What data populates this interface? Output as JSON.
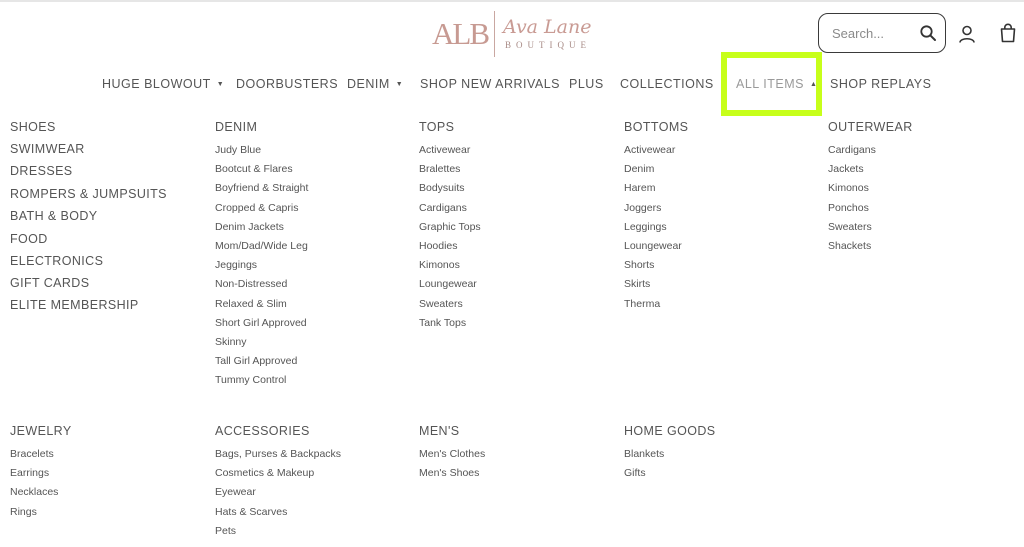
{
  "brand": {
    "monogram": "ALB",
    "script_name": "Ava Lane",
    "sub_name": "BOUTIQUE",
    "accent_color": "#c99b94"
  },
  "search": {
    "placeholder": "Search..."
  },
  "icons": {
    "search": "search-icon",
    "account": "account-icon",
    "cart": "shopping-bag-icon",
    "caret_down": "caret-down-icon",
    "caret_up": "caret-up-icon"
  },
  "highlight_color": "#c7ff1a",
  "nav": [
    {
      "label": "HUGE BLOWOUT",
      "has_caret": true
    },
    {
      "label": "DOORBUSTERS",
      "has_caret": false
    },
    {
      "label": "DENIM",
      "has_caret": true
    },
    {
      "label": "SHOP NEW ARRIVALS",
      "has_caret": false
    },
    {
      "label": "PLUS",
      "has_caret": false
    },
    {
      "label": "COLLECTIONS",
      "has_caret": true
    },
    {
      "label": "ALL ITEMS",
      "has_caret": true,
      "active": true
    },
    {
      "label": "SHOP REPLAYS",
      "has_caret": false
    }
  ],
  "menu": {
    "main_links": [
      "SHOES",
      "SWIMWEAR",
      "DRESSES",
      "ROMPERS & JUMPSUITS",
      "BATH & BODY",
      "FOOD",
      "ELECTRONICS",
      "GIFT CARDS",
      "ELITE MEMBERSHIP"
    ],
    "denim": {
      "heading": "DENIM",
      "links": [
        "Judy Blue",
        "Bootcut & Flares",
        "Boyfriend & Straight",
        "Cropped & Capris",
        "Denim Jackets",
        "Mom/Dad/Wide Leg",
        "Jeggings",
        "Non-Distressed",
        "Relaxed & Slim",
        "Short Girl Approved",
        "Skinny",
        "Tall Girl Approved",
        "Tummy Control"
      ]
    },
    "tops": {
      "heading": "TOPS",
      "links": [
        "Activewear",
        "Bralettes",
        "Bodysuits",
        "Cardigans",
        "Graphic Tops",
        "Hoodies",
        "Kimonos",
        "Loungewear",
        "Sweaters",
        "Tank Tops"
      ]
    },
    "bottoms": {
      "heading": "BOTTOMS",
      "links": [
        "Activewear",
        "Denim",
        "Harem",
        "Joggers",
        "Leggings",
        "Loungewear",
        "Shorts",
        "Skirts",
        "Therma"
      ]
    },
    "outerwear": {
      "heading": "OUTERWEAR",
      "links": [
        "Cardigans",
        "Jackets",
        "Kimonos",
        "Ponchos",
        "Sweaters",
        "Shackets"
      ]
    },
    "jewelry": {
      "heading": "JEWELRY",
      "links": [
        "Bracelets",
        "Earrings",
        "Necklaces",
        "Rings"
      ]
    },
    "accessories": {
      "heading": "ACCESSORIES",
      "links": [
        "Bags, Purses & Backpacks",
        "Cosmetics & Makeup",
        "Eyewear",
        "Hats & Scarves",
        "Pets"
      ]
    },
    "mens": {
      "heading": "MEN'S",
      "links": [
        "Men's Clothes",
        "Men's Shoes"
      ]
    },
    "home": {
      "heading": "HOME GOODS",
      "links": [
        "Blankets",
        "Gifts"
      ]
    }
  }
}
